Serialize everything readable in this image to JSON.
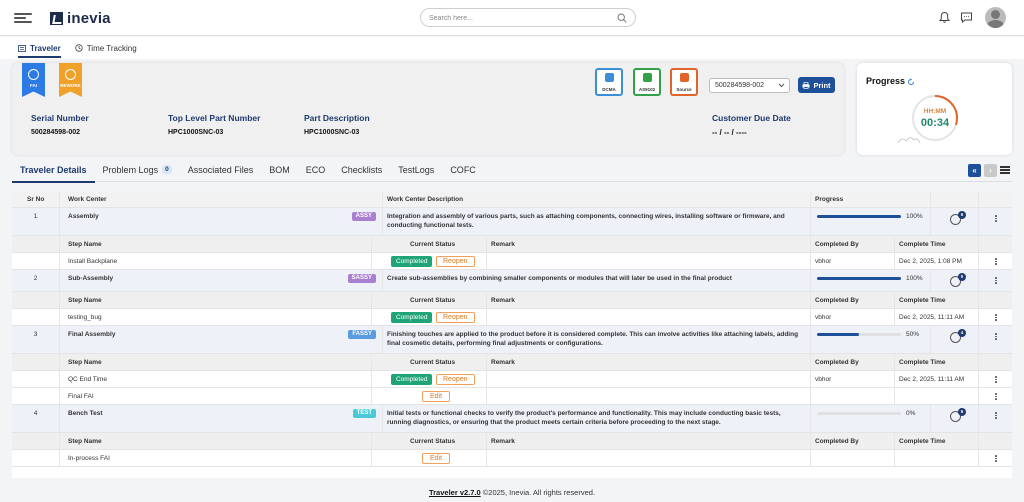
{
  "header": {
    "logo_text": "inevia",
    "search_placeholder": "Search here..."
  },
  "module_tabs": [
    {
      "label": "Traveler",
      "active": true
    },
    {
      "label": "Time Tracking",
      "active": false
    }
  ],
  "badges": [
    {
      "label": "FAI",
      "color": "#2c7be5"
    },
    {
      "label": "REWORK",
      "color": "#f0a12a"
    }
  ],
  "certs": [
    {
      "label": "DCMA",
      "color": "#3b8fd6"
    },
    {
      "label": "AS9102",
      "color": "#33a04a"
    },
    {
      "label": "Source",
      "color": "#e0652b"
    }
  ],
  "info": {
    "serial_label": "Serial Number",
    "serial_value": "500284598-002",
    "tlpn_label": "Top Level Part Number",
    "tlpn_value": "HPC1000SNC-03",
    "desc_label": "Part Description",
    "desc_value": "HPC1000SNC-03",
    "due_label": "Customer Due Date",
    "due_value": "-- / -- / ----",
    "serial_select": "500284598-002",
    "print_label": "Print"
  },
  "progress": {
    "title": "Progress",
    "ring_label": "HH:MM",
    "ring_value": "00:34",
    "fraction": 0.3
  },
  "sub_tabs": [
    {
      "label": "Traveler Details",
      "active": true
    },
    {
      "label": "Problem Logs",
      "count": "0"
    },
    {
      "label": "Associated Files"
    },
    {
      "label": "BOM"
    },
    {
      "label": "ECO"
    },
    {
      "label": "Checklists"
    },
    {
      "label": "TestLogs"
    },
    {
      "label": "COFC"
    }
  ],
  "table": {
    "headers": {
      "sr": "Sr No",
      "wc": "Work Center",
      "desc": "Work Center Description",
      "progress": "Progress"
    },
    "step_headers": {
      "step": "Step Name",
      "status": "Current Status",
      "remark": "Remark",
      "by": "Completed By",
      "time": "Complete Time"
    },
    "work_centers": [
      {
        "sr": "1",
        "name": "Assembly",
        "tag": "ASSY",
        "tag_color": "#a97fd1",
        "desc": "Integration and assembly of various parts, such as attaching components, connecting wires, installing software or firmware, and conducting functional tests.",
        "progress": 1.0,
        "pct": "100%",
        "docs": "6",
        "steps": [
          {
            "name": "Install Backplane",
            "status": "Completed",
            "action": "Reopen",
            "by": "vbhor",
            "time": "Dec 2, 2025, 1:08 PM"
          }
        ]
      },
      {
        "sr": "2",
        "name": "Sub-Assembly",
        "tag": "SASSY",
        "tag_color": "#a97fd1",
        "desc": "Create sub-assemblies by combining smaller components or modules that will later be used in the final product",
        "progress": 1.0,
        "pct": "100%",
        "docs": "0",
        "steps": [
          {
            "name": "testing_bug",
            "status": "Completed",
            "action": "Reopen",
            "by": "vbhor",
            "time": "Dec 2, 2025, 11:11 AM"
          }
        ]
      },
      {
        "sr": "3",
        "name": "Final Assembly",
        "tag": "FASSY",
        "tag_color": "#5b9be0",
        "desc": "Finishing touches are applied to the product before it is considered complete. This can involve activities like attaching labels, adding final cosmetic details, performing final adjustments or configurations.",
        "progress": 0.5,
        "pct": "50%",
        "docs": "4",
        "steps": [
          {
            "name": "QC End Time",
            "status": "Completed",
            "action": "Reopen",
            "by": "vbhor",
            "time": "Dec 2, 2025, 11:11 AM"
          },
          {
            "name": "Final FAI",
            "status": "",
            "action": "Edit",
            "by": "",
            "time": ""
          }
        ]
      },
      {
        "sr": "4",
        "name": "Bench Test",
        "tag": "TEST",
        "tag_color": "#4cc9d6",
        "desc": "Initial tests or functional checks to verify the product's performance and functionality. This may include conducting basic tests, running diagnostics, or ensuring that the product meets certain criteria before proceeding to the next stage.",
        "progress": 0.0,
        "pct": "0%",
        "docs": "6",
        "steps": [
          {
            "name": "In-process FAI",
            "status": "",
            "action": "Edit",
            "by": "",
            "time": ""
          }
        ]
      }
    ]
  },
  "footer": {
    "version": "Traveler v2.7.0",
    "copyright": " ©2025, Inevia. All rights reserved."
  }
}
